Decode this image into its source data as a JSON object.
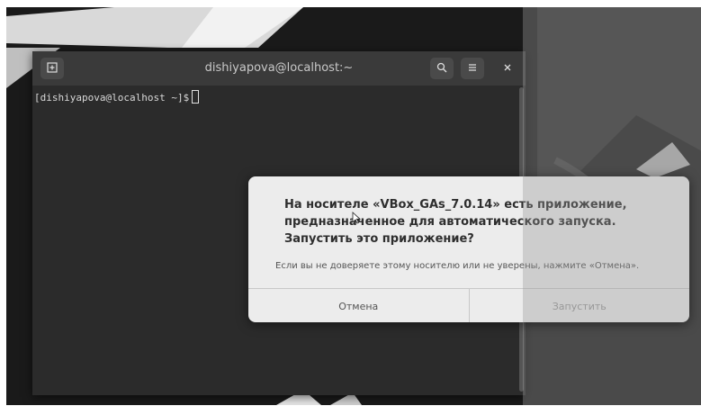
{
  "terminal": {
    "title": "dishiyapova@localhost:~",
    "new_tab_icon": "new-tab-icon",
    "search_icon": "search-icon",
    "menu_icon": "hamburger-menu-icon",
    "close_icon": "close-icon",
    "prompt": "[dishiyapova@localhost ~]$"
  },
  "dialog": {
    "heading": "На носителе «VBox_GAs_7.0.14» есть приложение, предназначенное для автоматического запуска. Запустить это приложение?",
    "body": "Если вы не доверяете этому носителю или не уверены, нажмите «Отмена».",
    "cancel_label": "Отмена",
    "run_label": "Запустить"
  },
  "colors": {
    "desktop": "#1c1c1c",
    "terminal_bg": "#2b2b2b",
    "titlebar": "#3a3a3a",
    "dialog_bg": "#ececec"
  }
}
